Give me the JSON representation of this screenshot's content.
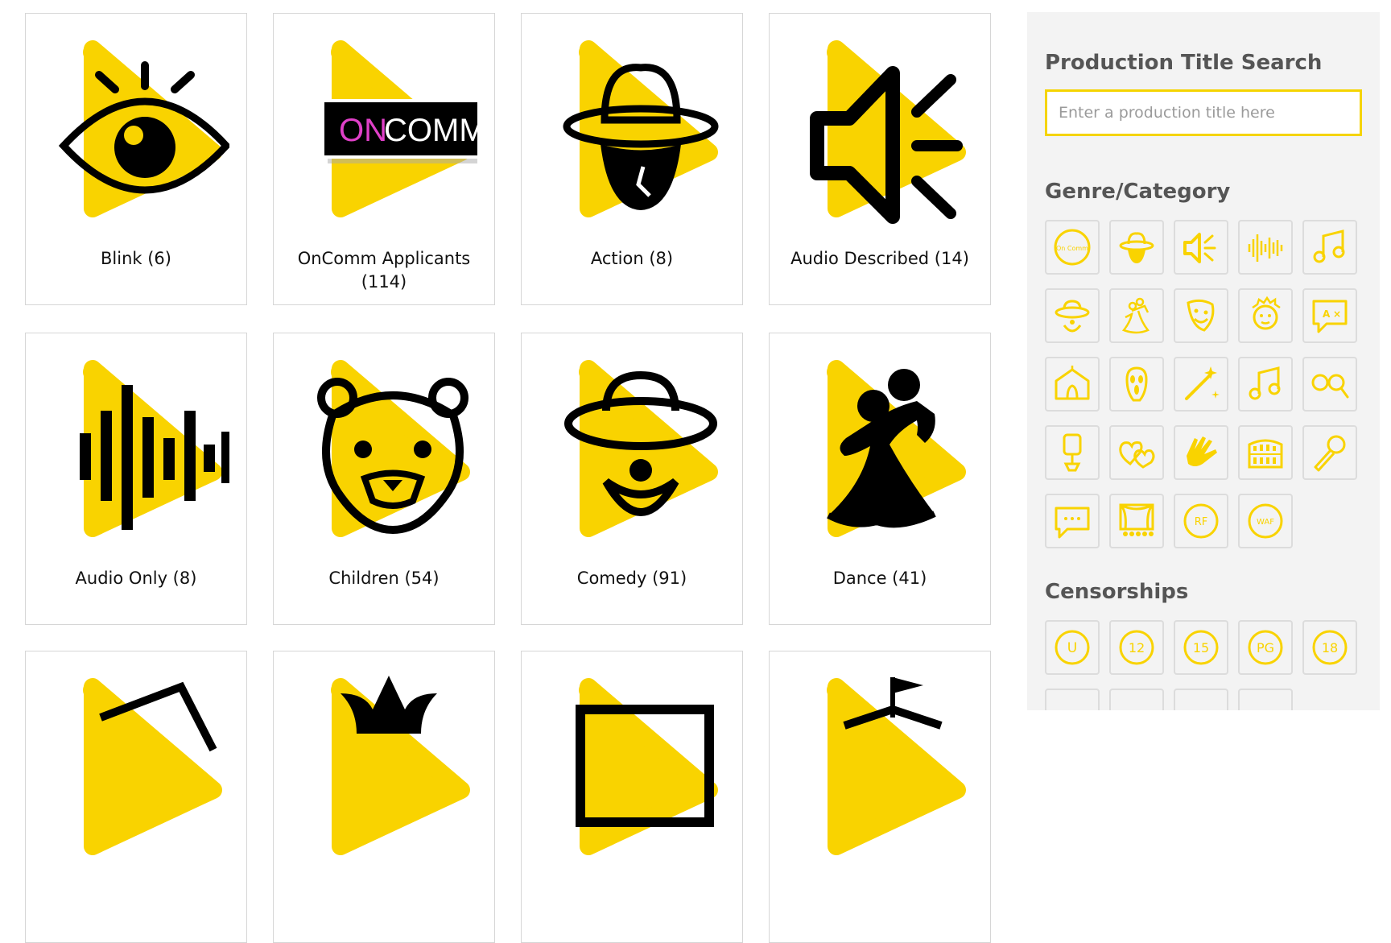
{
  "cards": [
    {
      "label": "Blink  (6)",
      "icon": "eye-icon"
    },
    {
      "label": "OnComm Applicants (114)",
      "icon": "oncomm-logo"
    },
    {
      "label": "Action  (8)",
      "icon": "fedora-hat-icon"
    },
    {
      "label": "Audio Described  (14)",
      "icon": "speaker-icon"
    },
    {
      "label": "Audio Only  (8)",
      "icon": "sound-wave-icon"
    },
    {
      "label": "Children  (54)",
      "icon": "bear-icon"
    },
    {
      "label": "Comedy  (91)",
      "icon": "clown-icon"
    },
    {
      "label": "Dance  (41)",
      "icon": "dancing-couple-icon"
    }
  ],
  "logo_text": {
    "on": "ON",
    "comm": "COMM"
  },
  "sidebar": {
    "search_heading": "Production Title Search",
    "search_placeholder": "Enter a production title here",
    "genre_heading": "Genre/Category",
    "censorship_heading": "Censorships",
    "genre_icons": [
      "oncomm-circle-icon",
      "fedora-hat-icon",
      "speaker-icon",
      "sound-wave-icon",
      "music-note-icon",
      "clown-icon",
      "dancing-couple-icon",
      "drama-mask-icon",
      "wild-hair-face-icon",
      "translate-icon",
      "circus-tent-icon",
      "scream-mask-icon",
      "magic-wand-icon",
      "music-note-icon",
      "glasses-icon",
      "microphone-stand-icon",
      "hearts-icon",
      "sign-language-icon",
      "colosseum-icon",
      "microphone-icon",
      "speech-bubble-icon",
      "theatre-stage-icon",
      "rf-badge-icon",
      "waf-badge-icon"
    ],
    "genre_badges": {
      "oncomm": "On Comm",
      "rf": "RF",
      "waf": "WAF"
    },
    "ratings": [
      "U",
      "12",
      "15",
      "PG",
      "18"
    ]
  },
  "colors": {
    "accent": "#F9D300",
    "icon_ink": "#000000",
    "tile_border": "#DCDCDC",
    "sidebar_bg": "#F3F3F3"
  }
}
